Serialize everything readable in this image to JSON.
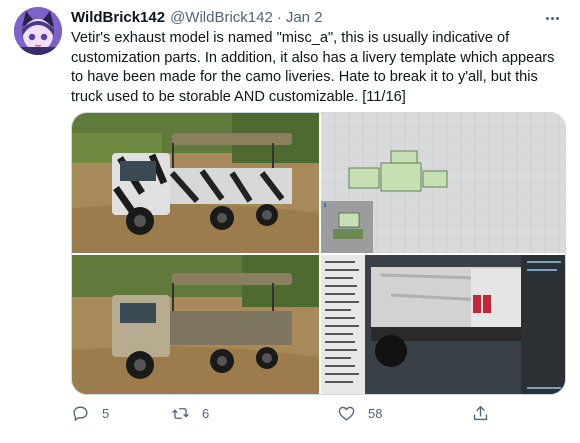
{
  "tweet": {
    "author_name": "WildBrick142",
    "handle": "@WildBrick142",
    "separator": "·",
    "date": "Jan 2",
    "text": "Vetir's exhaust model is named \"misc_a\", this is usually indicative of customization parts. In addition, it also has a livery template which appears to have been made for the camo liveries. Hate to break it to y'all, but this truck used to be storable AND customizable. [11/16]",
    "media": [
      {
        "kind": "photo",
        "subject": "camo-truck"
      },
      {
        "kind": "photo",
        "subject": "livery-template"
      },
      {
        "kind": "photo",
        "subject": "tan-truck"
      },
      {
        "kind": "photo",
        "subject": "model-viewer"
      }
    ],
    "actions": {
      "reply_count": "5",
      "retweet_count": "6",
      "like_count": "58"
    }
  },
  "icons": [
    "avatar",
    "more-icon",
    "reply-icon",
    "retweet-icon",
    "like-icon",
    "share-icon"
  ],
  "colors": {
    "text_primary": "#0f1419",
    "text_secondary": "#536471",
    "border": "#cfd9de"
  }
}
